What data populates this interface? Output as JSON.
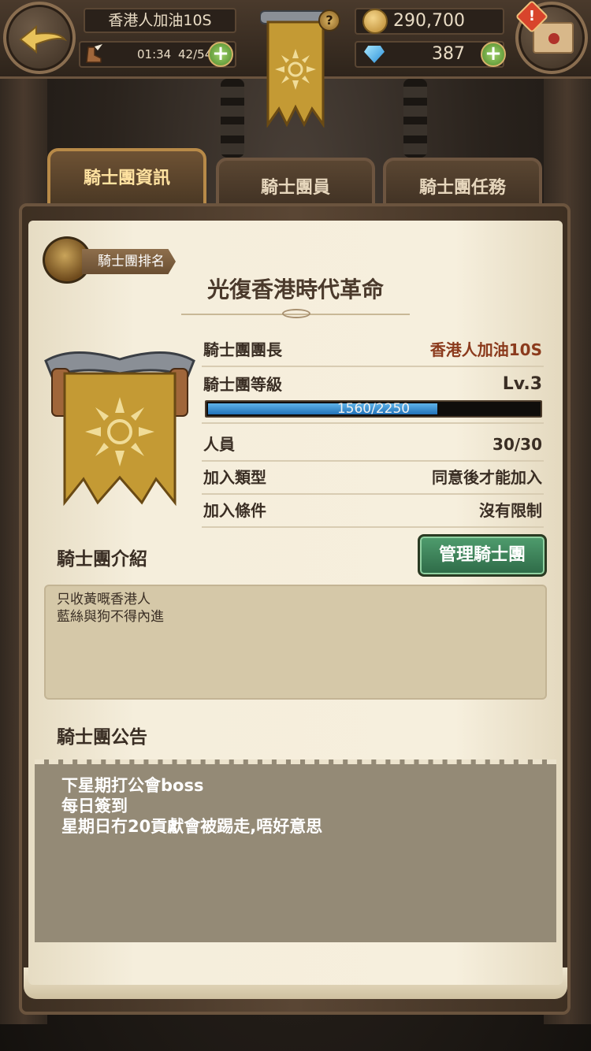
{
  "header": {
    "player_name": "香港人加油10S",
    "stamina_timer": "01:34",
    "stamina": "42/54",
    "gold": "290,700",
    "gems": "387",
    "alert_mark": "!",
    "help_mark": "?"
  },
  "tabs": [
    {
      "label": "騎士團資訊",
      "active": true
    },
    {
      "label": "騎士團員",
      "active": false
    },
    {
      "label": "騎士團任務",
      "active": false
    }
  ],
  "guild": {
    "rank_label": "騎士團排名",
    "name": "光復香港時代革命",
    "leader_label": "騎士團團長",
    "leader": "香港人加油10S",
    "level_label": "騎士團等級",
    "level": "Lv.3",
    "xp_text": "1560/2250",
    "xp_fraction": 0.693,
    "members_label": "人員",
    "members": "30/30",
    "join_type_label": "加入類型",
    "join_type": "同意後才能加入",
    "join_cond_label": "加入條件",
    "join_cond": "沒有限制"
  },
  "intro": {
    "label": "騎士團介紹",
    "manage_button": "管理騎士團",
    "lines": [
      "只收黃嘅香港人",
      "藍絲與狗不得內進"
    ]
  },
  "notice": {
    "label": "騎士團公告",
    "lines": [
      "下星期打公會boss",
      "每日簽到",
      "星期日冇20貢獻會被踢走,唔好意思"
    ]
  },
  "colors": {
    "accent_gold": "#c9a45a",
    "button_green": "#3f8a5c",
    "xp_blue": "#2f86c9"
  }
}
